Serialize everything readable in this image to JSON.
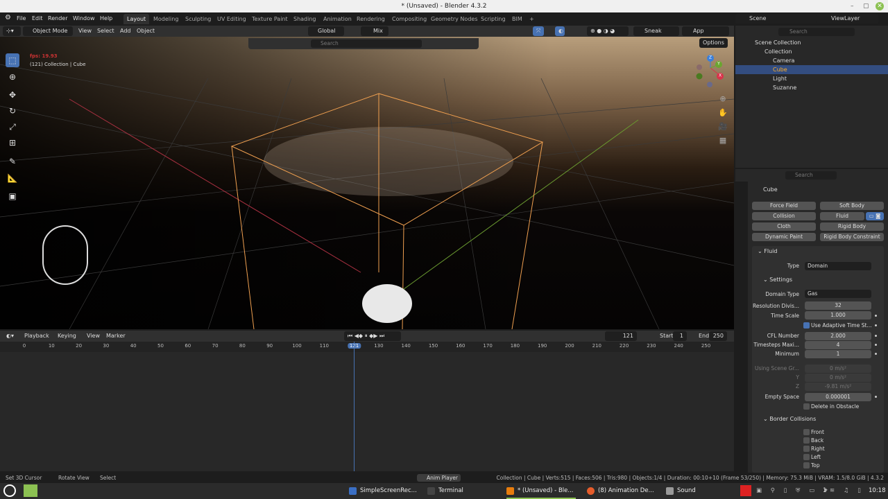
{
  "window": {
    "title": "* (Unsaved) - Blender 4.3.2"
  },
  "menu": [
    "File",
    "Edit",
    "Render",
    "Window",
    "Help"
  ],
  "workspaces": [
    "Layout",
    "Modeling",
    "Sculpting",
    "UV Editing",
    "Texture Paint",
    "Shading",
    "Animation",
    "Rendering",
    "Compositing",
    "Geometry Nodes",
    "Scripting",
    "BIM",
    "+"
  ],
  "topright": {
    "scene": "Scene",
    "viewlayer": "ViewLayer"
  },
  "viewport_header": {
    "mode": "Object Mode",
    "menus": [
      "View",
      "Select",
      "Add",
      "Object"
    ],
    "orientation": "Global",
    "snap": "Mix",
    "search_placeholder": "Search",
    "sneak_peek": "Sneak Peek",
    "app_manager": "App Manager",
    "options": "Options"
  },
  "viewport": {
    "fps": "fps: 19.93",
    "info": "(121) Collection | Cube",
    "axes": {
      "x": "X",
      "y": "Y",
      "z": "Z"
    }
  },
  "timeline": {
    "menus": [
      "Playback",
      "Keying",
      "View",
      "Marker"
    ],
    "current_frame": "121",
    "start_label": "Start",
    "start": "1",
    "end_label": "End",
    "end": "250",
    "ticks": [
      "0",
      "10",
      "20",
      "30",
      "40",
      "50",
      "60",
      "70",
      "80",
      "90",
      "100",
      "110",
      "121",
      "130",
      "140",
      "150",
      "160",
      "170",
      "180",
      "190",
      "200",
      "210",
      "220",
      "230",
      "240",
      "250"
    ]
  },
  "outliner": {
    "search_placeholder": "Search",
    "scene_collection": "Scene Collection",
    "collection": "Collection",
    "items": [
      "Camera",
      "Cube",
      "Light",
      "Suzanne"
    ],
    "selected": "Cube"
  },
  "properties": {
    "search_placeholder": "Search",
    "object": "Cube",
    "physics_buttons": [
      "Force Field",
      "Soft Body",
      "Collision",
      "Fluid",
      "Cloth",
      "Rigid Body",
      "Dynamic Paint",
      "Rigid Body Constraint"
    ],
    "fluid_panel": "Fluid",
    "type_label": "Type",
    "type": "Domain",
    "settings_panel": "Settings",
    "domain_type_label": "Domain Type",
    "domain_type": "Gas",
    "resolution_label": "Resolution Divis...",
    "resolution": "32",
    "time_scale_label": "Time Scale",
    "time_scale": "1.000",
    "adaptive_label": "Use Adaptive Time St...",
    "cfl_label": "CFL Number",
    "cfl": "2.000",
    "timesteps_max_label": "Timesteps Maxi...",
    "timesteps_max": "4",
    "minimum_label": "Minimum",
    "minimum": "1",
    "gravity_label": "Using Scene Gr...",
    "gravity_x": "0 m/s²",
    "gravity_y_label": "Y",
    "gravity_y": "0 m/s²",
    "gravity_z_label": "Z",
    "gravity_z": "-9.81 m/s²",
    "empty_space_label": "Empty Space",
    "empty_space": "0.000001",
    "delete_obstacle_label": "Delete in Obstacle",
    "border_panel": "Border Collisions",
    "borders": [
      "Front",
      "Back",
      "Right",
      "Left",
      "Top"
    ]
  },
  "statusbar": {
    "hints": [
      "Set 3D Cursor",
      "Rotate View",
      "Select"
    ],
    "anim_player": "Anim Player",
    "stats": "Collection | Cube | Verts:515 | Faces:506 | Tris:980 | Objects:1/4 | Duration: 00:10+10 (Frame 53/250) | Memory: 75.3 MiB | VRAM: 1.5/8.0 GiB | 4.3.2"
  },
  "taskbar": {
    "apps": [
      "SimpleScreenRec...",
      "Terminal",
      "* (Unsaved) - Ble...",
      "(8) Animation De...",
      "Sound"
    ],
    "tray_count": "1",
    "clock": "10:18"
  },
  "colors": {
    "accent": "#4772b3",
    "selection": "#ffa030",
    "bg": "#1d1d1d"
  }
}
